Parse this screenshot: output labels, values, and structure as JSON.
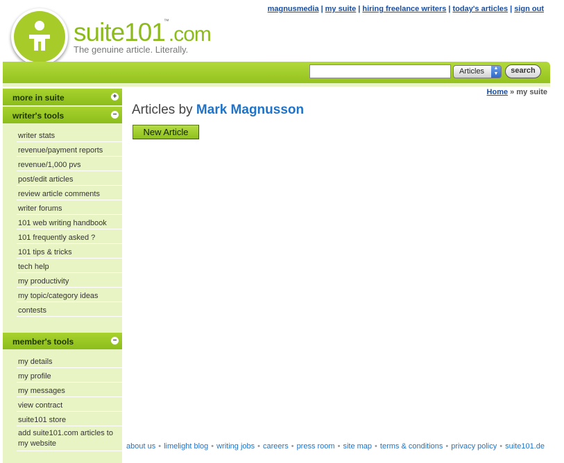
{
  "top_nav": {
    "links": [
      "magnusmedia",
      "my suite",
      "hiring freelance writers",
      "today's articles",
      "sign out"
    ],
    "separator": "|"
  },
  "logo": {
    "name": "suite101",
    "tm": "™",
    "domain": ".com",
    "tagline": "The genuine article. Literally."
  },
  "search": {
    "input_value": "",
    "select_value": "Articles",
    "button_label": "search"
  },
  "sidebar": {
    "sections": [
      {
        "label": "more in suite",
        "toggle": "+",
        "items": []
      },
      {
        "label": "writer's tools",
        "toggle": "−",
        "items": [
          "writer stats",
          "revenue/payment reports",
          "revenue/1,000 pvs",
          "post/edit articles",
          "review article comments",
          "writer forums",
          "101 web writing handbook",
          "101 frequently asked ?",
          "101 tips & tricks",
          "tech help",
          "my productivity",
          "my topic/category ideas",
          "contests"
        ]
      },
      {
        "label": "member's tools",
        "toggle": "−",
        "items": [
          "my details",
          "my profile",
          "my messages",
          "view contract",
          "suite101 store",
          "add suite101.com articles to my website"
        ]
      }
    ]
  },
  "breadcrumb": {
    "home": "Home",
    "sep": "»",
    "current": "my suite"
  },
  "main": {
    "title_prefix": "Articles by",
    "author": "Mark Magnusson",
    "new_article_label": "New Article"
  },
  "footer": {
    "links": [
      "about us",
      "limelight blog",
      "writing jobs",
      "careers",
      "press room",
      "site map",
      "terms & conditions",
      "privacy policy",
      "suite101.de"
    ],
    "sep": "•"
  },
  "colors": {
    "brand_green": "#a7cc2a",
    "sidebar_bg": "#e9f4c4",
    "link_blue": "#1a4d9e",
    "author_blue": "#1f73c8"
  }
}
